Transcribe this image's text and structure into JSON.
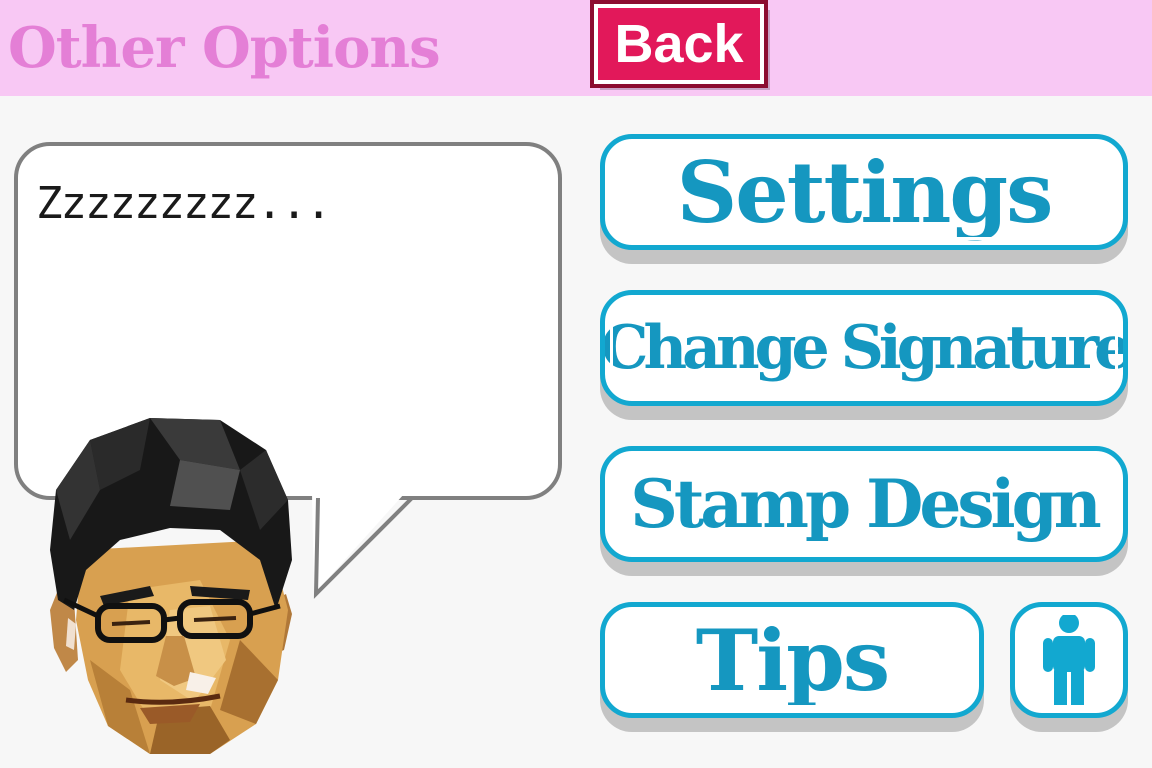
{
  "header": {
    "title": "Other Options",
    "back_label": "Back"
  },
  "bubble": {
    "text": "Zzzzzzzzz..."
  },
  "menu": {
    "settings_label": "Settings",
    "signature_label": "Change Signature",
    "stamp_label": "Stamp Design",
    "tips_label": "Tips",
    "extra_icon": "person-icon"
  },
  "colors": {
    "header_bg": "#f8c8f4",
    "title": "#e47fd6",
    "back_button": "#e2185a",
    "menu_border": "#12a8d0",
    "menu_text": "#1597c0"
  }
}
